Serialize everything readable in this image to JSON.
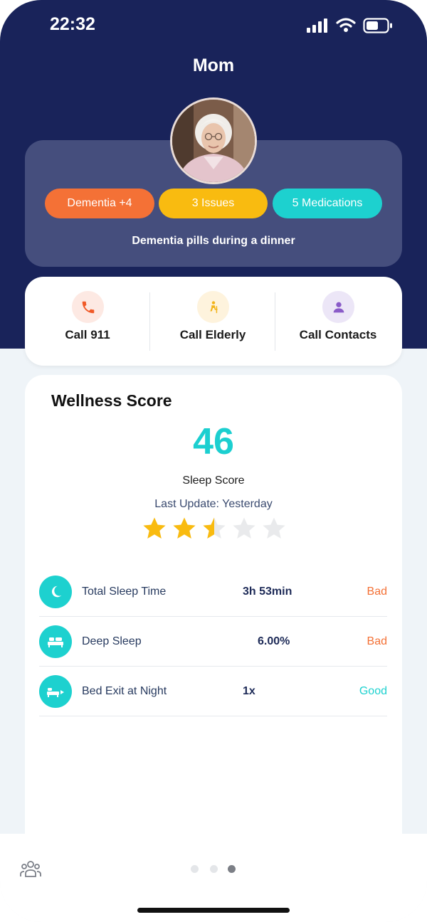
{
  "status_bar": {
    "time": "22:32"
  },
  "header": {
    "title": "Mom"
  },
  "profile": {
    "chips": [
      {
        "label": "Dementia +4",
        "color": "#f47136"
      },
      {
        "label": "3 Issues",
        "color": "#f9bb10"
      },
      {
        "label": "5 Medications",
        "color": "#1dd1cf"
      }
    ],
    "note": "Dementia pills during a dinner"
  },
  "actions": [
    {
      "label": "Call 911",
      "icon": "phone-icon"
    },
    {
      "label": "Call Elderly",
      "icon": "elderly-icon"
    },
    {
      "label": "Call Contacts",
      "icon": "contact-icon"
    }
  ],
  "wellness": {
    "title": "Wellness Score",
    "score": "46",
    "score_label": "Sleep Score",
    "last_update": "Last Update: Yesterday",
    "rating": 2.5,
    "rating_max": 5,
    "metrics": [
      {
        "name": "Total Sleep Time",
        "value": "3h 53min",
        "status": "Bad",
        "icon": "moon-icon"
      },
      {
        "name": "Deep Sleep",
        "value": "6.00%",
        "status": "Bad",
        "icon": "bed-icon"
      },
      {
        "name": "Bed Exit at Night",
        "value": "1x",
        "status": "Good",
        "icon": "bed-exit-icon"
      }
    ]
  },
  "colors": {
    "header_bg": "#19235a",
    "accent_teal": "#1dd1cf",
    "bad": "#f47136",
    "good": "#1dd1cf",
    "star": "#f9bb10"
  },
  "pager": {
    "pages": 3,
    "active": 3
  }
}
